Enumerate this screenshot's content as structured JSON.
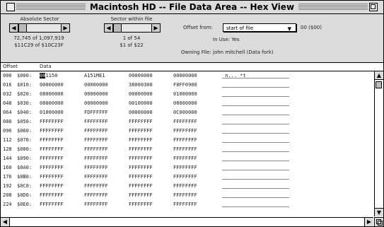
{
  "window": {
    "title": "Macintosh HD -- File Data Area -- Hex View"
  },
  "header": {
    "absolute_sector": {
      "label": "Absolute Sector",
      "position": "72,745 of 1,097,919",
      "hex": "$11C29 of $10C23F",
      "thumb_position": 0.0
    },
    "sector_within_file": {
      "label": "Sector within file",
      "position": "1 of 54",
      "hex": "$1 of $22",
      "thumb_position": 0.0
    },
    "offset_from": {
      "label": "Offset from:",
      "value": "start of file",
      "suffix": "00 ($00)"
    },
    "in_use": "In Use: Yes",
    "owning_file": "Owning File: john mitchell (Data fork)"
  },
  "columns": {
    "offset": "Offset",
    "data": "Data"
  },
  "rows": [
    {
      "dec": "000",
      "hex": "$000:",
      "words": [
        "0F1150",
        "A151ME1",
        "00000000",
        "00000000"
      ],
      "ascii": "_n... *t"
    },
    {
      "dec": "016",
      "hex": "$010:",
      "words": [
        "00000000",
        "00000000",
        "38000300",
        "F8FF0900"
      ],
      "ascii": ""
    },
    {
      "dec": "032",
      "hex": "$020:",
      "words": [
        "08000000",
        "00000000",
        "00000000",
        "01000000"
      ],
      "ascii": ""
    },
    {
      "dec": "048",
      "hex": "$030:",
      "words": [
        "08000000",
        "00000000",
        "00100000",
        "08000000"
      ],
      "ascii": ""
    },
    {
      "dec": "064",
      "hex": "$040:",
      "words": [
        "01000000",
        "FDFFFFFF",
        "00000000",
        "0C000000"
      ],
      "ascii": ""
    },
    {
      "dec": "080",
      "hex": "$050:",
      "words": [
        "FFFFFFFF",
        "FFFFFFFF",
        "FFFFFFFF",
        "FFFFFFFF"
      ],
      "ascii": ""
    },
    {
      "dec": "096",
      "hex": "$060:",
      "words": [
        "FFFFFFFF",
        "FFFFFFFF",
        "FFFFFFFF",
        "FFFFFFFF"
      ],
      "ascii": ""
    },
    {
      "dec": "112",
      "hex": "$070:",
      "words": [
        "FFFFFFFF",
        "FFFFFFFF",
        "FFFFFFFF",
        "FFFFFFFF"
      ],
      "ascii": ""
    },
    {
      "dec": "128",
      "hex": "$080:",
      "words": [
        "FFFFFFFF",
        "FFFFFFFF",
        "FFFFFFFF",
        "FFFFFFFF"
      ],
      "ascii": ""
    },
    {
      "dec": "144",
      "hex": "$090:",
      "words": [
        "FFFFFFFF",
        "FFFFFFFF",
        "FFFFFFFF",
        "FFFFFFFF"
      ],
      "ascii": ""
    },
    {
      "dec": "160",
      "hex": "$0A0:",
      "words": [
        "FFFFFFFF",
        "FFFFFFFF",
        "FFFFFFFF",
        "FFFFFFFF"
      ],
      "ascii": ""
    },
    {
      "dec": "176",
      "hex": "$0B0:",
      "words": [
        "FFFFFFFF",
        "FFFFFFFF",
        "FFFFFFFF",
        "FFFFFFFF"
      ],
      "ascii": ""
    },
    {
      "dec": "192",
      "hex": "$0C0:",
      "words": [
        "FFFFFFFF",
        "FFFFFFFF",
        "FFFFFFFF",
        "FFFFFFFF"
      ],
      "ascii": ""
    },
    {
      "dec": "208",
      "hex": "$0D0:",
      "words": [
        "FFFFFFFF",
        "FFFFFFFF",
        "FFFFFFFF",
        "FFFFFFFF"
      ],
      "ascii": ""
    },
    {
      "dec": "224",
      "hex": "$0E0:",
      "words": [
        "FFFFFFFF",
        "FFFFFFFF",
        "FFFFFFFF",
        "FFFFFFFF"
      ],
      "ascii": ""
    }
  ],
  "cursor_byte": "00",
  "icons": {
    "left_arrow": "◀",
    "right_arrow": "▶",
    "up_arrow": "▲",
    "down_arrow": "▼",
    "popup_arrow": "▼"
  }
}
